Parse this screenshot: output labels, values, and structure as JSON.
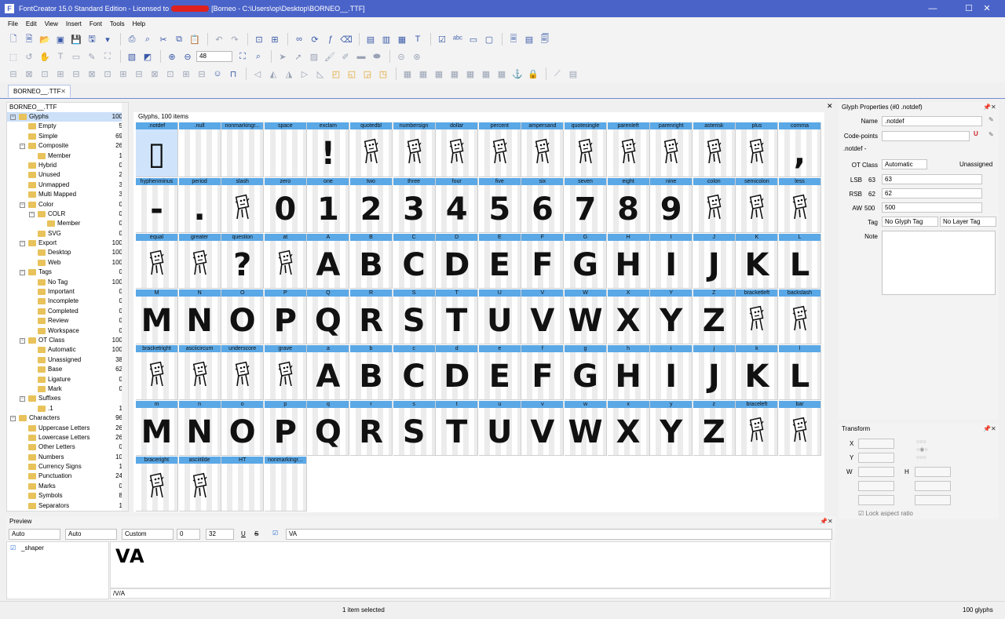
{
  "window": {
    "title": "FontCreator 15.0 Standard Edition - Licensed to",
    "title_path": "[Borneo - C:\\Users\\op\\Desktop\\BORNEO__.TTF]",
    "minimize": "—",
    "maximize": "☐",
    "close": "✕"
  },
  "menu": [
    "File",
    "Edit",
    "View",
    "Insert",
    "Font",
    "Tools",
    "Help"
  ],
  "toolbar": {
    "zoom_value": "48"
  },
  "document_tab": {
    "label": "BORNEO__.TTF",
    "close": "✕"
  },
  "tree": {
    "header": "BORNEO__.TTF",
    "items": [
      {
        "label": "Glyphs",
        "count": "100",
        "level": 0,
        "expand": "−",
        "selected": true
      },
      {
        "label": "Empty",
        "count": "5",
        "level": 1
      },
      {
        "label": "Simple",
        "count": "69",
        "level": 1
      },
      {
        "label": "Composite",
        "count": "26",
        "level": 1,
        "expand": "−"
      },
      {
        "label": "Member",
        "count": "1",
        "level": 2
      },
      {
        "label": "Hybrid",
        "count": "0",
        "level": 1
      },
      {
        "label": "Unused",
        "count": "2",
        "level": 1
      },
      {
        "label": "Unmapped",
        "count": "3",
        "level": 1
      },
      {
        "label": "Multi Mapped",
        "count": "3",
        "level": 1
      },
      {
        "label": "Color",
        "count": "0",
        "level": 1,
        "expand": "−"
      },
      {
        "label": "COLR",
        "count": "0",
        "level": 2,
        "expand": "−"
      },
      {
        "label": "Member",
        "count": "0",
        "level": 3
      },
      {
        "label": "SVG",
        "count": "0",
        "level": 2
      },
      {
        "label": "Export",
        "count": "100",
        "level": 1,
        "expand": "−"
      },
      {
        "label": "Desktop",
        "count": "100",
        "level": 2
      },
      {
        "label": "Web",
        "count": "100",
        "level": 2
      },
      {
        "label": "Tags",
        "count": "0",
        "level": 1,
        "expand": "−"
      },
      {
        "label": "No Tag",
        "count": "100",
        "level": 2
      },
      {
        "label": "Important",
        "count": "0",
        "level": 2
      },
      {
        "label": "Incomplete",
        "count": "0",
        "level": 2
      },
      {
        "label": "Completed",
        "count": "0",
        "level": 2
      },
      {
        "label": "Review",
        "count": "0",
        "level": 2
      },
      {
        "label": "Workspace",
        "count": "0",
        "level": 2
      },
      {
        "label": "OT Class",
        "count": "100",
        "level": 1,
        "expand": "−"
      },
      {
        "label": "Automatic",
        "count": "100",
        "level": 2
      },
      {
        "label": "Unassigned",
        "count": "38",
        "level": 2
      },
      {
        "label": "Base",
        "count": "62",
        "level": 2
      },
      {
        "label": "Ligature",
        "count": "0",
        "level": 2
      },
      {
        "label": "Mark",
        "count": "0",
        "level": 2
      },
      {
        "label": "Suffixes",
        "count": "",
        "level": 1,
        "expand": "−"
      },
      {
        "label": ".1",
        "count": "1",
        "level": 2
      },
      {
        "label": "Characters",
        "count": "96",
        "level": 0,
        "expand": "−"
      },
      {
        "label": "Uppercase Letters",
        "count": "26",
        "level": 1
      },
      {
        "label": "Lowercase Letters",
        "count": "26",
        "level": 1
      },
      {
        "label": "Other Letters",
        "count": "0",
        "level": 1
      },
      {
        "label": "Numbers",
        "count": "10",
        "level": 1
      },
      {
        "label": "Currency Signs",
        "count": "1",
        "level": 1
      },
      {
        "label": "Punctuation",
        "count": "24",
        "level": 1
      },
      {
        "label": "Marks",
        "count": "0",
        "level": 1
      },
      {
        "label": "Symbols",
        "count": "8",
        "level": 1
      },
      {
        "label": "Separators",
        "count": "1",
        "level": 1
      }
    ]
  },
  "glyphs": {
    "title": "Glyphs, 100 items",
    "items": [
      {
        "name": ".notdef",
        "ch": "▯"
      },
      {
        "name": ".null",
        "ch": ""
      },
      {
        "name": "nonmarkingr...",
        "ch": ""
      },
      {
        "name": "space",
        "ch": ""
      },
      {
        "name": "exclam",
        "ch": "!"
      },
      {
        "name": "quotedbl",
        "ch": ""
      },
      {
        "name": "numbersign",
        "ch": ""
      },
      {
        "name": "dollar",
        "ch": ""
      },
      {
        "name": "percent",
        "ch": ""
      },
      {
        "name": "ampersand",
        "ch": ""
      },
      {
        "name": "quotesingle",
        "ch": ""
      },
      {
        "name": "parenleft",
        "ch": ""
      },
      {
        "name": "parenright",
        "ch": ""
      },
      {
        "name": "asterisk",
        "ch": ""
      },
      {
        "name": "plus",
        "ch": ""
      },
      {
        "name": "comma",
        "ch": ","
      },
      {
        "name": "hyphenminus",
        "ch": "-"
      },
      {
        "name": "period",
        "ch": "."
      },
      {
        "name": "slash",
        "ch": ""
      },
      {
        "name": "zero",
        "ch": "0"
      },
      {
        "name": "one",
        "ch": "1"
      },
      {
        "name": "two",
        "ch": "2"
      },
      {
        "name": "three",
        "ch": "3"
      },
      {
        "name": "four",
        "ch": "4"
      },
      {
        "name": "five",
        "ch": "5"
      },
      {
        "name": "six",
        "ch": "6"
      },
      {
        "name": "seven",
        "ch": "7"
      },
      {
        "name": "eight",
        "ch": "8"
      },
      {
        "name": "nine",
        "ch": "9"
      },
      {
        "name": "colon",
        "ch": ""
      },
      {
        "name": "semicolon",
        "ch": ""
      },
      {
        "name": "less",
        "ch": ""
      },
      {
        "name": "equal",
        "ch": ""
      },
      {
        "name": "greater",
        "ch": ""
      },
      {
        "name": "question",
        "ch": "?"
      },
      {
        "name": "at",
        "ch": ""
      },
      {
        "name": "A",
        "ch": "A"
      },
      {
        "name": "B",
        "ch": "B"
      },
      {
        "name": "C",
        "ch": "C"
      },
      {
        "name": "D",
        "ch": "D"
      },
      {
        "name": "E",
        "ch": "E"
      },
      {
        "name": "F",
        "ch": "F"
      },
      {
        "name": "G",
        "ch": "G"
      },
      {
        "name": "H",
        "ch": "H"
      },
      {
        "name": "I",
        "ch": "I"
      },
      {
        "name": "J",
        "ch": "J"
      },
      {
        "name": "K",
        "ch": "K"
      },
      {
        "name": "L",
        "ch": "L"
      },
      {
        "name": "M",
        "ch": "M"
      },
      {
        "name": "N",
        "ch": "N"
      },
      {
        "name": "O",
        "ch": "O"
      },
      {
        "name": "P",
        "ch": "P"
      },
      {
        "name": "Q",
        "ch": "Q"
      },
      {
        "name": "R",
        "ch": "R"
      },
      {
        "name": "S",
        "ch": "S"
      },
      {
        "name": "T",
        "ch": "T"
      },
      {
        "name": "U",
        "ch": "U"
      },
      {
        "name": "V",
        "ch": "V"
      },
      {
        "name": "W",
        "ch": "W"
      },
      {
        "name": "X",
        "ch": "X"
      },
      {
        "name": "Y",
        "ch": "Y"
      },
      {
        "name": "Z",
        "ch": "Z"
      },
      {
        "name": "bracketleft",
        "ch": ""
      },
      {
        "name": "backslash",
        "ch": ""
      },
      {
        "name": "bracketright",
        "ch": ""
      },
      {
        "name": "asciicircum",
        "ch": ""
      },
      {
        "name": "underscore",
        "ch": ""
      },
      {
        "name": "grave",
        "ch": ""
      },
      {
        "name": "a",
        "ch": "A"
      },
      {
        "name": "b",
        "ch": "B"
      },
      {
        "name": "c",
        "ch": "C"
      },
      {
        "name": "d",
        "ch": "D"
      },
      {
        "name": "e",
        "ch": "E"
      },
      {
        "name": "f",
        "ch": "F"
      },
      {
        "name": "g",
        "ch": "G"
      },
      {
        "name": "h",
        "ch": "H"
      },
      {
        "name": "i",
        "ch": "I"
      },
      {
        "name": "j",
        "ch": "J"
      },
      {
        "name": "k",
        "ch": "K"
      },
      {
        "name": "l",
        "ch": "L"
      },
      {
        "name": "m",
        "ch": "M"
      },
      {
        "name": "n",
        "ch": "N"
      },
      {
        "name": "o",
        "ch": "O"
      },
      {
        "name": "p",
        "ch": "P"
      },
      {
        "name": "q",
        "ch": "Q"
      },
      {
        "name": "r",
        "ch": "R"
      },
      {
        "name": "s",
        "ch": "S"
      },
      {
        "name": "t",
        "ch": "T"
      },
      {
        "name": "u",
        "ch": "U"
      },
      {
        "name": "v",
        "ch": "V"
      },
      {
        "name": "w",
        "ch": "W"
      },
      {
        "name": "x",
        "ch": "X"
      },
      {
        "name": "y",
        "ch": "Y"
      },
      {
        "name": "z",
        "ch": "Z"
      },
      {
        "name": "braceleft",
        "ch": ""
      },
      {
        "name": "bar",
        "ch": ""
      },
      {
        "name": "braceright",
        "ch": ""
      },
      {
        "name": "asciitilde",
        "ch": ""
      },
      {
        "name": "HT",
        "ch": ""
      },
      {
        "name": "nonmarkingr...",
        "ch": ""
      }
    ],
    "picture_glyphs": [
      "quotedbl",
      "numbersign",
      "dollar",
      "percent",
      "ampersand",
      "quotesingle",
      "parenleft",
      "parenright",
      "asterisk",
      "plus",
      "slash",
      "colon",
      "semicolon",
      "less",
      "equal",
      "greater",
      "at",
      "bracketleft",
      "backslash",
      "bracketright",
      "asciicircum",
      "underscore",
      "grave",
      "braceleft",
      "bar",
      "braceright",
      "asciitilde"
    ]
  },
  "props": {
    "header": "Glyph Properties (#0 .notdef)",
    "name_label": "Name",
    "name_value": ".notdef",
    "codepoints_label": "Code-points",
    "codepoints_value": "",
    "subtitle": ".notdef -",
    "otclass_label": "OT Class",
    "otclass_value": "Automatic",
    "otclass_status": "Unassigned",
    "lsb_label": "LSB",
    "lsb_num": "63",
    "lsb_value": "63",
    "rsb_label": "RSB",
    "rsb_num": "62",
    "rsb_value": "62",
    "aw_label": "AW",
    "aw_num": "500",
    "aw_value": "500",
    "tag_label": "Tag",
    "tag_value": "No Glyph Tag",
    "layer_tag_value": "No Layer Tag",
    "note_label": "Note"
  },
  "transform": {
    "header": "Transform",
    "x_label": "X",
    "y_label": "Y",
    "w_label": "W",
    "h_label": "H",
    "lock_label": "Lock aspect ratio"
  },
  "preview": {
    "header": "Preview",
    "sel1": "Auto",
    "sel2": "Auto",
    "sel3": "Custom",
    "spin1": "0",
    "spin2": "32",
    "text_value": "VA",
    "shaper_label": "_shaper",
    "sample_text": "VA",
    "glyph_path": "/V/A"
  },
  "status": {
    "selected": "1 item selected",
    "count": "100 glyphs"
  },
  "colors": {
    "titlebar": "#4a63c9",
    "glyph_header": "#5ba8e6",
    "selection": "#cfe4fb"
  }
}
